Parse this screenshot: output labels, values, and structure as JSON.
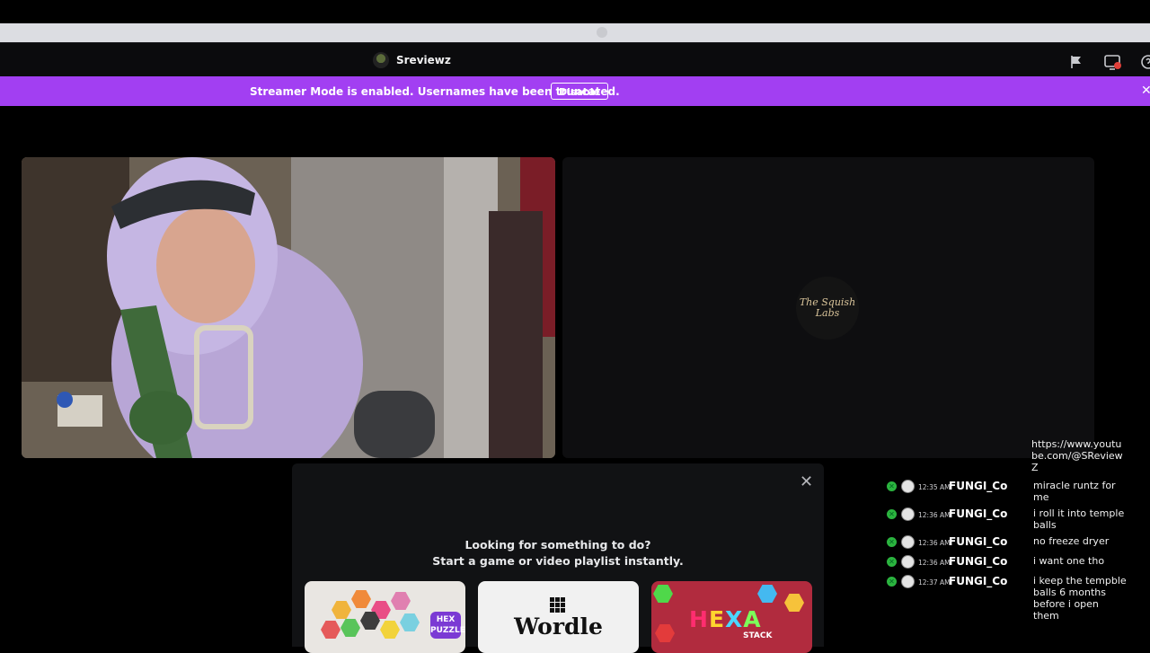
{
  "title_bar": {
    "channel_name": "Sreviewz"
  },
  "banner": {
    "text": "Streamer Mode is enabled. Usernames have been truncated.",
    "disable_label": "Disable",
    "close_glyph": "✕",
    "background": "#a23ff2"
  },
  "video_right": {
    "logo_text": "The Squish Labs"
  },
  "activity": {
    "close_glyph": "✕",
    "title_line1": "Looking for something to do?",
    "title_line2": "Start a game or video playlist instantly.",
    "cards": [
      {
        "name": "Hex Puzzle",
        "badge": "HEX PUZZLE"
      },
      {
        "name": "Wordle",
        "label": "Wordle"
      },
      {
        "name": "Hexa Stack",
        "label": "HEXA",
        "sub": "STACK"
      }
    ]
  },
  "chat": {
    "first_message": "https://www.youtube.com/@SReviewZ",
    "messages": [
      {
        "time": "12:35 AM",
        "user": "FUNGI_Co",
        "text": "miracle runtz for me"
      },
      {
        "time": "12:36 AM",
        "user": "FUNGI_Co",
        "text": "i roll it into temple balls"
      },
      {
        "time": "12:36 AM",
        "user": "FUNGI_Co",
        "text": "no freeze dryer"
      },
      {
        "time": "12:36 AM",
        "user": "FUNGI_Co",
        "text": "i want one tho"
      },
      {
        "time": "12:37 AM",
        "user": "FUNGI_Co",
        "text": "i keep the tempble balls 6 months before i open them"
      }
    ]
  },
  "icons": [
    "flag-icon",
    "screen-share-icon",
    "help-icon",
    "close-icon",
    "moderator-badge-icon"
  ]
}
